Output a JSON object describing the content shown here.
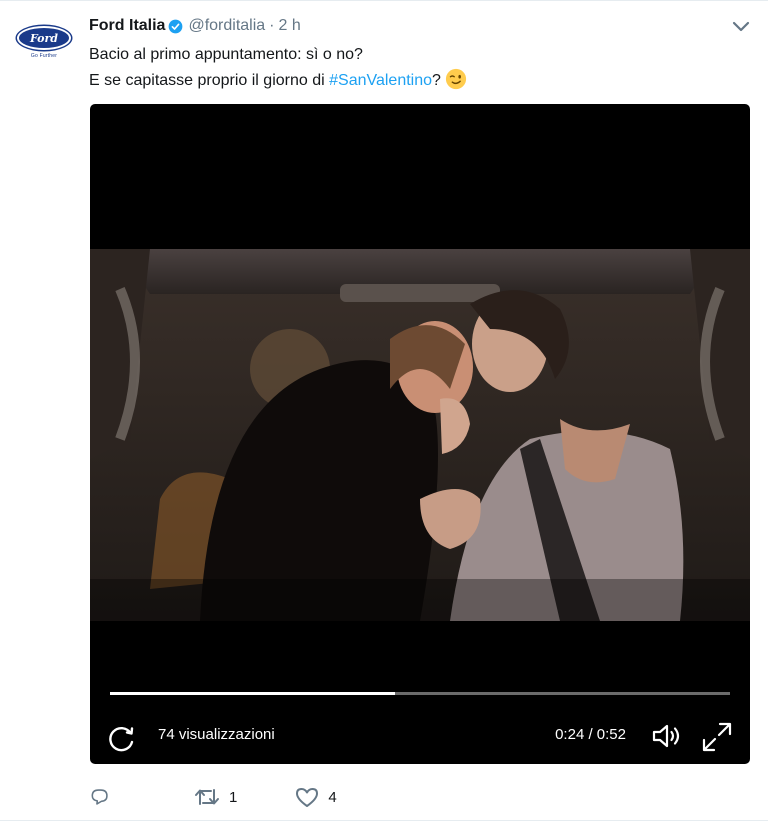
{
  "tweet": {
    "author_name": "Ford Italia",
    "handle": "@forditalia",
    "separator": "·",
    "time": "2 h",
    "text_line1": "Bacio al primo appuntamento: sì o no?",
    "text_line2_prefix": "E se capitasse proprio il giorno di ",
    "hashtag": "#SanValentino",
    "text_line2_suffix": "?",
    "emoji": "winking-face"
  },
  "avatar": {
    "logo_text": "Ford",
    "tagline": "Go Further"
  },
  "video": {
    "views_label": "74 visualizzazioni",
    "time_label": "0:24 / 0:52",
    "progress": 0.46
  },
  "actions": {
    "reply_count": "",
    "retweet_count": "1",
    "like_count": "4"
  },
  "colors": {
    "link": "#1da1f2",
    "secondary_text": "#657786",
    "verified": "#1da1f2",
    "ford_blue": "#1a3a8a"
  }
}
